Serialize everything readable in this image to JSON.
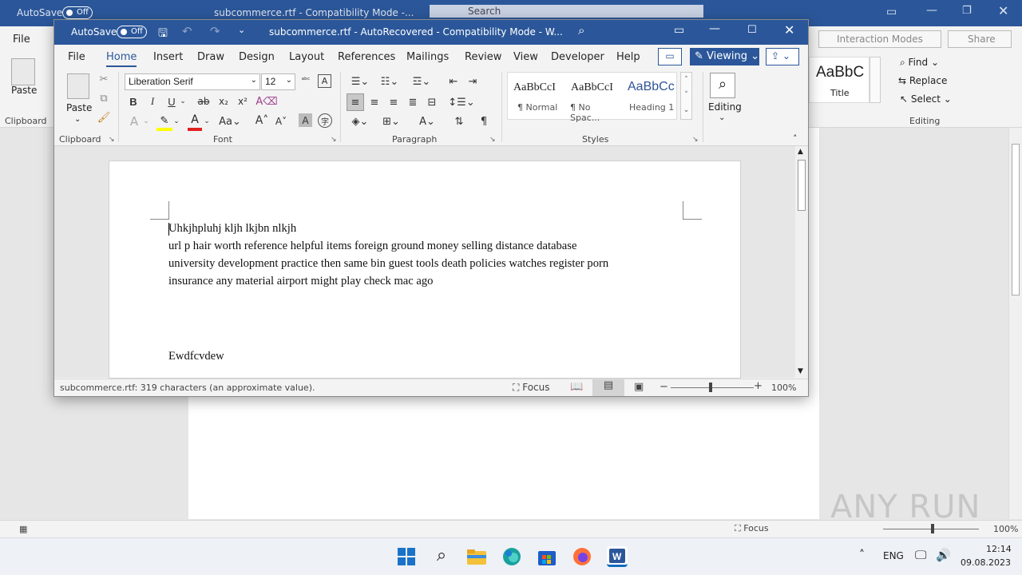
{
  "background_window": {
    "autosave_label": "AutoSave",
    "autosave_state": "Off",
    "title": "subcommerce.rtf  -  Compatibility Mode  -...",
    "search_placeholder": "Search",
    "file_tab": "File",
    "paste_label": "Paste",
    "clipboard_label": "Clipboard",
    "interaction_modes": "Interaction Modes",
    "share": "Share",
    "style_preview": "AaBbC",
    "style_title": "Title",
    "find": "Find",
    "replace": "Replace",
    "select": "Select",
    "editing_label": "Editing",
    "focus": "Focus",
    "zoom": "100%"
  },
  "window": {
    "autosave_label": "AutoSave",
    "autosave_state": "Off",
    "title": "subcommerce.rtf  -  AutoRecovered  -  Compatibility Mode  -  W...",
    "tabs": [
      "File",
      "Home",
      "Insert",
      "Draw",
      "Design",
      "Layout",
      "References",
      "Mailings",
      "Review",
      "View",
      "Developer",
      "Help"
    ],
    "viewing_label": "Viewing"
  },
  "ribbon": {
    "paste_label": "Paste",
    "clipboard_label": "Clipboard",
    "font_name": "Liberation Serif",
    "font_size": "12",
    "font_label": "Font",
    "paragraph_label": "Paragraph",
    "styles_label": "Styles",
    "styles": [
      {
        "preview": "AaBbCcI",
        "name": "¶ Normal"
      },
      {
        "preview": "AaBbCcI",
        "name": "¶ No Spac..."
      },
      {
        "preview": "AaBbCc",
        "name": "Heading 1"
      }
    ],
    "editing_label": "Editing",
    "bold": "B",
    "italic": "I",
    "underline": "U",
    "strike": "ab",
    "fontsize_up": "A",
    "fontsize_down": "A",
    "case": "Aa"
  },
  "document": {
    "lines": [
      "Uhkjhpluhj kljh lkjbn  nlkjh",
      "url p hair  worth reference helpful items foreign ground  money  selling  distance   database",
      "university   development     practice then same    bin guest tools death policies  watches register porn",
      "insurance any material  airport might play check mac ago",
      "Ewdfcvdew"
    ]
  },
  "status": {
    "text": "subcommerce.rtf: 319 characters (an approximate value).",
    "focus": "Focus",
    "zoom": "100%"
  },
  "taskbar": {
    "lang": "ENG",
    "time": "12:14",
    "date": "09.08.2023"
  },
  "watermark": "ANY RUN",
  "colors": {
    "word_blue": "#2b579a",
    "accent": "#0f6cbd"
  }
}
